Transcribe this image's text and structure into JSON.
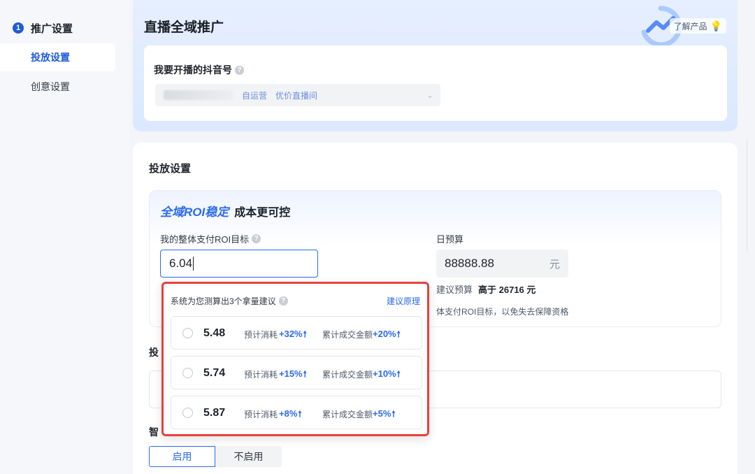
{
  "sidenav": {
    "step_number": "1",
    "step_label": "推广设置",
    "items": [
      {
        "label": "投放设置",
        "active": true
      },
      {
        "label": "创意设置",
        "active": false
      }
    ]
  },
  "header": {
    "title": "直播全域推广",
    "learn_product": "了解产品"
  },
  "account": {
    "label": "我要开播的抖音号",
    "tags": [
      "自运营",
      "优价直播间"
    ]
  },
  "delivery": {
    "title": "投放设置",
    "roi_accent": "全域ROI稳定",
    "roi_sub": "成本更可控",
    "roi_label": "我的整体支付ROI目标",
    "roi_value": "6.04",
    "budget_label": "日预算",
    "budget_value": "88888.88",
    "budget_unit": "元",
    "suggest_label": "建议预算",
    "suggest_value": "高于 26716 元",
    "roi_note": "体支付ROI目标，以免失去保障资格",
    "section2_label_partial": "投",
    "section3_label_partial": "智",
    "toggle_on": "启用",
    "toggle_off": "不启用"
  },
  "popover": {
    "title": "系统为您测算出3个拿量建议",
    "link": "建议原理",
    "metric1_label": "预计消耗",
    "metric2_label": "累计成交金额",
    "options": [
      {
        "value": "5.48",
        "metric1": "+32%",
        "metric2": "+20%"
      },
      {
        "value": "5.74",
        "metric1": "+15%",
        "metric2": "+10%"
      },
      {
        "value": "5.87",
        "metric1": "+8%",
        "metric2": "+5%"
      }
    ]
  },
  "colors": {
    "primary": "#2a6af1",
    "highlight_border": "#e8413b"
  }
}
